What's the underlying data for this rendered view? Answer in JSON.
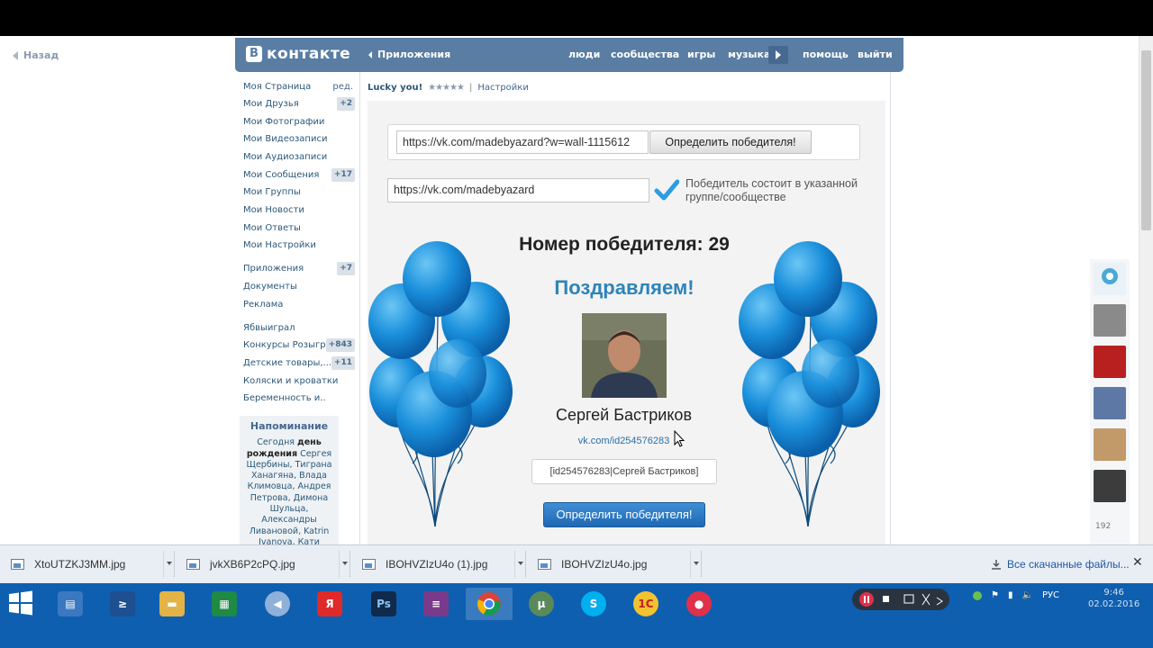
{
  "browser": {
    "back_label": "Назад"
  },
  "vk_header": {
    "logo_letter": "В",
    "logo_text": "контакте",
    "apps_link": "Приложения",
    "nav": [
      "люди",
      "сообщества",
      "игры",
      "музыка",
      "помощь",
      "выйти"
    ]
  },
  "left_menu": {
    "items": [
      {
        "label": "Моя Страница",
        "extra": "ред."
      },
      {
        "label": "Мои Друзья",
        "count": "+2"
      },
      {
        "label": "Мои Фотографии"
      },
      {
        "label": "Мои Видеозаписи"
      },
      {
        "label": "Мои Аудиозаписи"
      },
      {
        "label": "Мои Сообщения",
        "count": "+17"
      },
      {
        "label": "Мои Группы"
      },
      {
        "label": "Мои Новости"
      },
      {
        "label": "Мои Ответы"
      },
      {
        "label": "Мои Настройки"
      },
      {
        "label": "Приложения",
        "count": "+7"
      },
      {
        "label": "Документы"
      },
      {
        "label": "Реклама"
      },
      {
        "label": "Ябвыиграл"
      },
      {
        "label": "Конкурсы Розыгр...",
        "count": "+843"
      },
      {
        "label": "Детские товары,...",
        "count": "+11"
      },
      {
        "label": "Коляски и кроватки"
      },
      {
        "label": "Беременность и.."
      }
    ]
  },
  "reminder": {
    "title": "Напоминание",
    "text_prefix": "Сегодня ",
    "text_bold": "день рождения",
    "text_names": " Сергея Щербины, Тиграна Ханагяна, Влада Климовца, Андрея Петрова, Димона Шульца, Александры Ливановой, Katrin Ivanova, Кати"
  },
  "app": {
    "name": "Lucky you!",
    "stars": "★★★★★",
    "separator": "|",
    "settings_link": "Настройки",
    "post_url": "https://vk.com/madebyazard?w=wall-1115612",
    "determine_button": "Определить победителя!",
    "group_url": "https://vk.com/madebyazard",
    "group_note": "Победитель состоит в указанной группе/сообществе",
    "winner_number_text": "Номер победителя: 29",
    "congrats": "Поздравляем!",
    "winner_name": "Сергей Бастриков",
    "winner_link": "vk.com/id254576283",
    "winner_code": "[id254576283|Сергей Бастриков]",
    "main_button": "Определить победителя!"
  },
  "right_strip": {
    "count": "192"
  },
  "downloads": {
    "items": [
      "XtoUTZKJ3MM.jpg",
      "jvkXB6P2cPQ.jpg",
      "IBOHVZIzU4o (1).jpg",
      "IBOHVZIzU4o.jpg"
    ],
    "all_label": "Все скачанные файлы...",
    "close": "✕"
  },
  "taskbar": {
    "icons": [
      "explorer-icon",
      "powershell-icon",
      "folder-icon",
      "excel-icon",
      "speaker-icon",
      "yandex-icon",
      "photoshop-icon",
      "winrar-icon",
      "chrome-icon",
      "torrent-icon",
      "skype-icon",
      "1c-icon",
      "recorder-icon"
    ],
    "lang": "РУС",
    "time": "9:46",
    "date": "02.02.2016"
  },
  "colors": {
    "vk_blue": "#597da3",
    "taskbar": "#0e5fb0",
    "balloon": "#1a8fdb",
    "button_blue": "#2a78c4"
  }
}
